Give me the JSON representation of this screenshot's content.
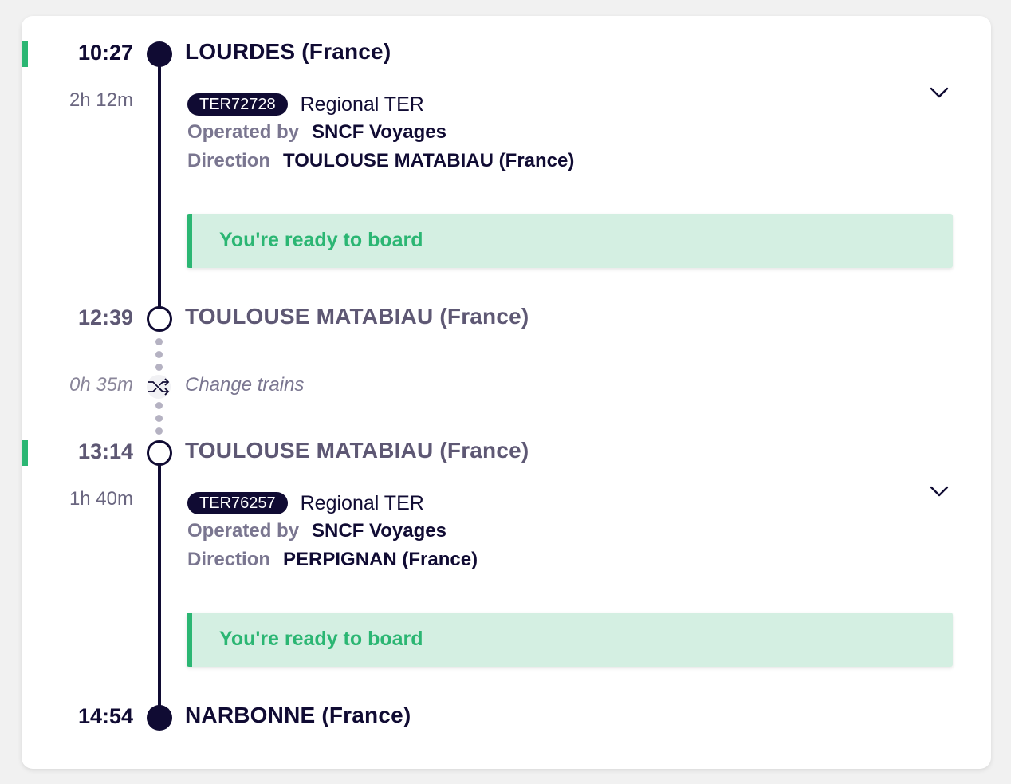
{
  "journey": {
    "stops": [
      {
        "time": "10:27",
        "station": "LOURDES (France)"
      },
      {
        "time": "12:39",
        "station": "TOULOUSE MATABIAU (France)"
      },
      {
        "time": "13:14",
        "station": "TOULOUSE MATABIAU (France)"
      },
      {
        "time": "14:54",
        "station": "NARBONNE (France)"
      }
    ],
    "legs": [
      {
        "duration": "2h 12m",
        "train_number": "TER72728",
        "train_type": "Regional TER",
        "operated_by_label": "Operated by",
        "operator": "SNCF Voyages",
        "direction_label": "Direction",
        "direction": "TOULOUSE MATABIAU (France)",
        "status": "You're ready to board"
      },
      {
        "duration": "1h 40m",
        "train_number": "TER76257",
        "train_type": "Regional TER",
        "operated_by_label": "Operated by",
        "operator": "SNCF Voyages",
        "direction_label": "Direction",
        "direction": "PERPIGNAN (France)",
        "status": "You're ready to board"
      }
    ],
    "transfer": {
      "duration": "0h 35m",
      "label": "Change trains",
      "icon": "shuffle-icon"
    }
  },
  "colors": {
    "primary": "#100b33",
    "accent_green": "#2bb673",
    "ready_background": "#d4efe2",
    "muted_text": "#5e5874"
  }
}
